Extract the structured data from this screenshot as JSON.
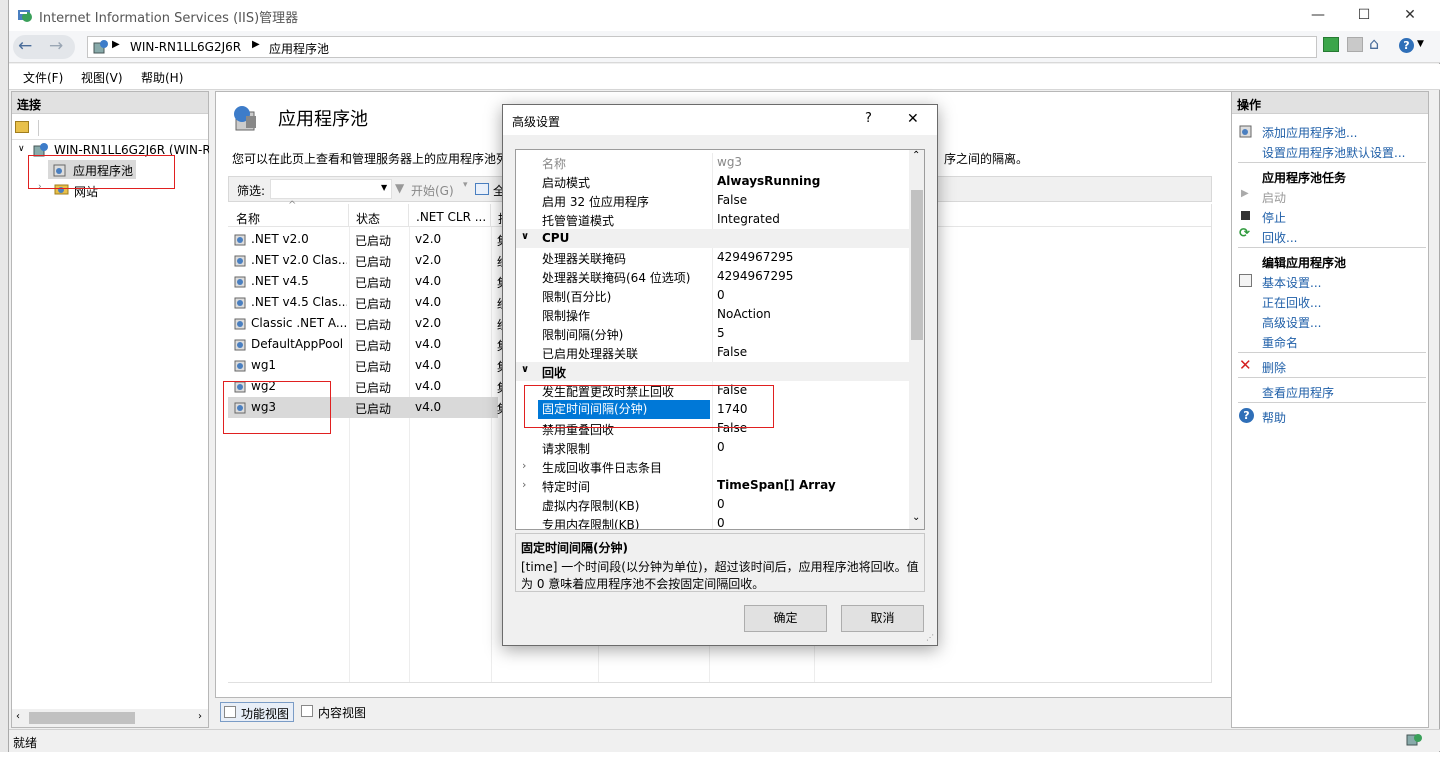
{
  "window": {
    "title": "Internet Information Services (IIS)管理器",
    "minimize": "—",
    "maximize": "☐",
    "close": "✕"
  },
  "address": {
    "crumbs": [
      "WIN-RN1LL6G2J6R",
      "应用程序池"
    ]
  },
  "menu": [
    "文件(F)",
    "视图(V)",
    "帮助(H)"
  ],
  "connections": {
    "header": "连接",
    "server": "WIN-RN1LL6G2J6R (WIN-R",
    "pools": "应用程序池",
    "sites": "网站"
  },
  "main": {
    "title": "应用程序池",
    "desc_left": "您可以在此页上查看和管理服务器上的应用程序池列",
    "desc_right": "序之间的隔离。",
    "filter_label": "筛选:",
    "start_label": "开始(G)",
    "showall_label": "全",
    "columns": [
      "名称",
      "状态",
      ".NET CLR ...",
      "托"
    ],
    "rows": [
      {
        "name": ".NET v2.0",
        "status": "已启动",
        "clr": "v2.0",
        "mode": "集"
      },
      {
        "name": ".NET v2.0 Clas...",
        "status": "已启动",
        "clr": "v2.0",
        "mode": "经"
      },
      {
        "name": ".NET v4.5",
        "status": "已启动",
        "clr": "v4.0",
        "mode": "集"
      },
      {
        "name": ".NET v4.5 Clas...",
        "status": "已启动",
        "clr": "v4.0",
        "mode": "经"
      },
      {
        "name": "Classic .NET A...",
        "status": "已启动",
        "clr": "v2.0",
        "mode": "经"
      },
      {
        "name": "DefaultAppPool",
        "status": "已启动",
        "clr": "v4.0",
        "mode": "集"
      },
      {
        "name": "wg1",
        "status": "已启动",
        "clr": "v4.0",
        "mode": "集"
      },
      {
        "name": "wg2",
        "status": "已启动",
        "clr": "v4.0",
        "mode": "集"
      },
      {
        "name": "wg3",
        "status": "已启动",
        "clr": "v4.0",
        "mode": "集"
      }
    ],
    "tab_features": "功能视图",
    "tab_content": "内容视图"
  },
  "status": "就绪",
  "actions": {
    "header": "操作",
    "add_pool": "添加应用程序池...",
    "set_defaults": "设置应用程序池默认设置...",
    "tasks_head": "应用程序池任务",
    "start": "启动",
    "stop": "停止",
    "recycle": "回收...",
    "edit_head": "编辑应用程序池",
    "basic": "基本设置...",
    "recycling": "正在回收...",
    "advanced": "高级设置...",
    "rename": "重命名",
    "delete": "删除",
    "view_apps": "查看应用程序",
    "help": "帮助"
  },
  "dialog": {
    "title": "高级设置",
    "help": "?",
    "close": "✕",
    "props": [
      {
        "kind": "prop",
        "name": "名称",
        "value": "wg3",
        "gray": true
      },
      {
        "kind": "prop",
        "name": "启动模式",
        "value": "AlwaysRunning",
        "bold": true
      },
      {
        "kind": "prop",
        "name": "启用 32 位应用程序",
        "value": "False"
      },
      {
        "kind": "prop",
        "name": "托管管道模式",
        "value": "Integrated"
      },
      {
        "kind": "cat",
        "name": "CPU"
      },
      {
        "kind": "prop",
        "name": "处理器关联掩码",
        "value": "4294967295"
      },
      {
        "kind": "prop",
        "name": "处理器关联掩码(64 位选项)",
        "value": "4294967295"
      },
      {
        "kind": "prop",
        "name": "限制(百分比)",
        "value": "0"
      },
      {
        "kind": "prop",
        "name": "限制操作",
        "value": "NoAction"
      },
      {
        "kind": "prop",
        "name": "限制间隔(分钟)",
        "value": "5"
      },
      {
        "kind": "prop",
        "name": "已启用处理器关联",
        "value": "False"
      },
      {
        "kind": "cat",
        "name": "回收"
      },
      {
        "kind": "prop",
        "name": "发生配置更改时禁止回收",
        "value": "False"
      },
      {
        "kind": "prop",
        "name": "固定时间间隔(分钟)",
        "value": "1740",
        "selected": true
      },
      {
        "kind": "prop",
        "name": "禁用重叠回收",
        "value": "False"
      },
      {
        "kind": "prop",
        "name": "请求限制",
        "value": "0"
      },
      {
        "kind": "expand",
        "name": "生成回收事件日志条目",
        "value": ""
      },
      {
        "kind": "expand",
        "name": "特定时间",
        "value": "TimeSpan[] Array",
        "bold": true
      },
      {
        "kind": "prop",
        "name": "虚拟内存限制(KB)",
        "value": "0"
      },
      {
        "kind": "prop",
        "name": "专用内存限制(KB)",
        "value": "0"
      }
    ],
    "desc_title": "固定时间间隔(分钟)",
    "desc_line1": "[time] 一个时间段(以分钟为单位)，超过该时间后，应用程序池将回收。值",
    "desc_line2": "为 0 意味着应用程序池不会按固定间隔回收。",
    "ok": "确定",
    "cancel": "取消"
  }
}
